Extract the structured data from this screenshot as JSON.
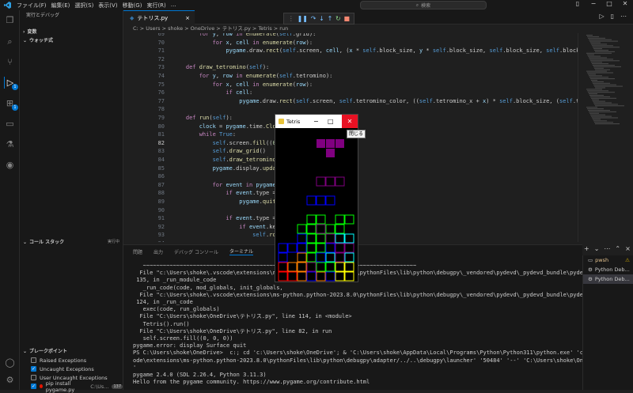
{
  "menu": [
    "ファイル(F)",
    "編集(E)",
    "選択(S)",
    "表示(V)",
    "移動(G)",
    "実行(R)"
  ],
  "search": {
    "label": "検索"
  },
  "sidebar": {
    "header": "実行とデバッグ",
    "variables": "変数",
    "watch": "ウォッチ式",
    "callstack": "コール スタック",
    "callstack_status": "実行中",
    "breakpoints": "ブレークポイント",
    "bp_items": [
      {
        "label": "Raised Exceptions",
        "checked": false
      },
      {
        "label": "Uncaught Exceptions",
        "checked": true
      },
      {
        "label": "User Uncaught Exceptions",
        "checked": false
      },
      {
        "label": "pip install pygame.py",
        "checked": true,
        "detail": "C:\\Us...",
        "count": "137"
      }
    ]
  },
  "activity": {
    "run_badge": "1",
    "ext_badge": "1"
  },
  "editor": {
    "tab_label": "テトリス.py",
    "breadcrumb": "C: > Users > shoke > OneDrive > テトリス.py > Tetris > run",
    "current_line": 82,
    "lines": [
      {
        "n": 69,
        "text": "        for y, row in enumerate(self.grid):"
      },
      {
        "n": 70,
        "text": "            for x, cell in enumerate(row):"
      },
      {
        "n": 71,
        "text": "                pygame.draw.rect(self.screen, cell, (x * self.block_size, y * self.block_size, self.block_size, self.block_size), not"
      },
      {
        "n": 72,
        "text": ""
      },
      {
        "n": 73,
        "text": "    def draw_tetromino(self):"
      },
      {
        "n": 74,
        "text": "        for y, row in enumerate(self.tetromino):"
      },
      {
        "n": 75,
        "text": "            for x, cell in enumerate(row):"
      },
      {
        "n": 76,
        "text": "                if cell:"
      },
      {
        "n": 77,
        "text": "                    pygame.draw.rect(self.screen, self.tetromino_color, ((self.tetromino_x + x) * self.block_size, (self.tetromino_y +"
      },
      {
        "n": 78,
        "text": ""
      },
      {
        "n": 79,
        "text": "    def run(self):"
      },
      {
        "n": 80,
        "text": "        clock = pygame.time.Clock()"
      },
      {
        "n": 81,
        "text": "        while True:"
      },
      {
        "n": 82,
        "text": "            self.screen.fill((0, 0, 0))"
      },
      {
        "n": 83,
        "text": "            self.draw_grid()"
      },
      {
        "n": 84,
        "text": "            self.draw_tetromino()"
      },
      {
        "n": 85,
        "text": "            pygame.display.update()"
      },
      {
        "n": 86,
        "text": ""
      },
      {
        "n": 87,
        "text": "            for event in pygame.event.g"
      },
      {
        "n": 88,
        "text": "                if event.type == pygame"
      },
      {
        "n": 89,
        "text": "                    pygame.quit()"
      },
      {
        "n": 90,
        "text": ""
      },
      {
        "n": 91,
        "text": "                if event.type == pygame"
      },
      {
        "n": 92,
        "text": "                    if event.key == pyg"
      },
      {
        "n": 93,
        "text": "                        self.rotate_tet"
      },
      {
        "n": 94,
        "text": ""
      },
      {
        "n": 95,
        "text": "                    if event.key == pyg                          eck_collision(0, 1):"
      }
    ]
  },
  "panel": {
    "tabs": [
      "問題",
      "出力",
      "デバッグ コンソール",
      "ターミナル"
    ],
    "active_tab": 3,
    "terminal_lines": [
      "   ~~~~~~~~~~~~~~~~~~~~~~~~~~~~~~~~~~~~~~~~~~~~~~~~~~~~~~~~~~~~~~~~~~~~~~~~~~~~~~~~~~",
      "  File \"c:\\Users\\shoke\\.vscode\\extensions\\ms-python.python-2023.8.0\\pythonFiles\\lib\\python\\debugpy\\_vendored\\pydevd\\_pydevd_bundle\\pydevd_runpy.py\", line",
      " 135, in _run_module_code",
      "   _run_code(code, mod_globals, init_globals,",
      "  File \"c:\\Users\\shoke\\.vscode\\extensions\\ms-python.python-2023.8.0\\pythonFiles\\lib\\python\\debugpy\\_vendored\\pydevd\\_pydevd_bundle\\pydevd_runpy.py\", line",
      " 124, in _run_code",
      "   exec(code, run_globals)",
      "  File \"C:\\Users\\shoke\\OneDrive\\テトリス.py\", line 114, in <module>",
      "   Tetris().run()",
      "  File \"C:\\Users\\shoke\\OneDrive\\テトリス.py\", line 82, in run",
      "   self.screen.fill((0, 0, 0))",
      "pygame.error: display Surface quit",
      "PS C:\\Users\\shoke\\OneDrive>  c:; cd 'c:\\Users\\shoke\\OneDrive'; & 'C:\\Users\\shoke\\AppData\\Local\\Programs\\Python\\Python311\\python.exe' 'c:\\Users\\shoke\\.vsc",
      "ode\\extensions\\ms-python.python-2023.8.0\\pythonFiles\\lib\\python\\debugpy\\adapter/../..\\debugpy\\launcher' '50484' '--' 'C:\\Users\\shoke\\OneDrive\\テトリス.py",
      "'",
      "pygame 2.4.0 (SDL 2.26.4, Python 3.11.3)",
      "Hello from the pygame community. https://www.pygame.org/contribute.html"
    ],
    "terminals": [
      "pwsh",
      "Python Deb...",
      "Python Deb..."
    ]
  },
  "pygame_window": {
    "title": "Tetris",
    "tooltip": "閉じる",
    "falling_color": "#800080",
    "colors": {
      "purple": "#800080",
      "blue": "#0000ff",
      "green": "#00ff00",
      "cyan": "#00ffff",
      "orange": "#ff8000",
      "red": "#ff0000",
      "yellow": "#ffff00"
    }
  }
}
